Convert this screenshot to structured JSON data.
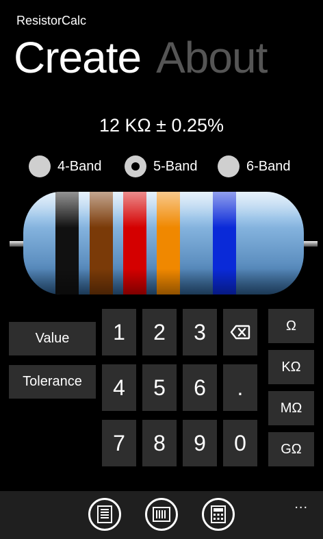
{
  "app": {
    "title": "ResistorCalc"
  },
  "pivot": {
    "tabs": [
      {
        "label": "Create"
      },
      {
        "label": "About"
      }
    ]
  },
  "result": {
    "text": "12 KΩ ± 0.25%"
  },
  "band_options": [
    {
      "label": "4-Band",
      "checked": false
    },
    {
      "label": "5-Band",
      "checked": true
    },
    {
      "label": "6-Band",
      "checked": false
    }
  ],
  "resistor": {
    "body_color": "#6fa3d0",
    "bands": [
      {
        "color": "#111111",
        "meaning": "black"
      },
      {
        "color": "#7a3a08",
        "meaning": "brown"
      },
      {
        "color": "#d40000",
        "meaning": "red"
      },
      {
        "color": "#f08800",
        "meaning": "orange"
      },
      {
        "color": "#0a2ad8",
        "meaning": "blue"
      }
    ]
  },
  "keypad": {
    "value_label": "Value",
    "tolerance_label": "Tolerance",
    "digits": [
      "1",
      "2",
      "3",
      "4",
      "5",
      "6",
      "7",
      "8",
      "9",
      "0"
    ],
    "decimal": ".",
    "backspace_icon": "backspace-icon",
    "units": [
      "Ω",
      "KΩ",
      "MΩ",
      "GΩ"
    ]
  },
  "appbar": {
    "icons": [
      "list-icon",
      "barcode-icon",
      "calculator-icon"
    ],
    "more": "..."
  }
}
